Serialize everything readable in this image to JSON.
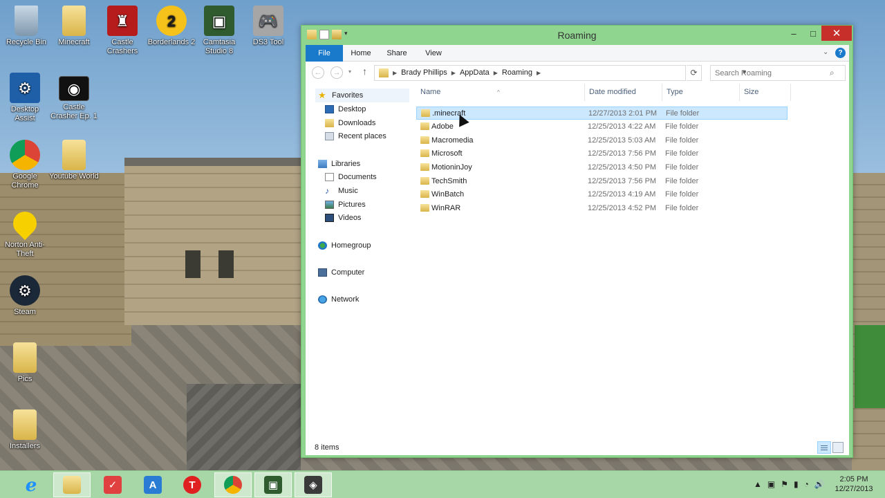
{
  "desktop": {
    "icons": [
      {
        "label": "Recycle Bin",
        "icon": "recycle-bin-icon"
      },
      {
        "label": "Minecraft",
        "icon": "folder-icon"
      },
      {
        "label": "Castle Crashers",
        "icon": "castle-crashers-icon"
      },
      {
        "label": "Borderlands 2",
        "icon": "borderlands-icon"
      },
      {
        "label": "Camtasia Studio 8",
        "icon": "camtasia-icon"
      },
      {
        "label": "DS3 Tool",
        "icon": "gamepad-icon"
      },
      {
        "label": "Desktop Assist",
        "icon": "desktop-assist-icon"
      },
      {
        "label": "Castle Crasher Ep. 1",
        "icon": "video-file-icon"
      },
      {
        "label": "Google Chrome",
        "icon": "chrome-icon"
      },
      {
        "label": "Youtube World",
        "icon": "folder-icon"
      },
      {
        "label": "Norton Anti-Theft",
        "icon": "norton-icon"
      },
      {
        "label": "Steam",
        "icon": "steam-icon"
      },
      {
        "label": "Pics",
        "icon": "folder-icon"
      },
      {
        "label": "Installers",
        "icon": "folder-icon"
      }
    ]
  },
  "window": {
    "title": "Roaming",
    "controls": {
      "minimize": "–",
      "maximize": "□",
      "close": "✕"
    },
    "ribbon": {
      "tabs": [
        "File",
        "Home",
        "Share",
        "View"
      ],
      "help": "?"
    },
    "address": {
      "crumbs": [
        "Brady Phillips",
        "AppData",
        "Roaming"
      ],
      "search_placeholder": "Search Roaming"
    },
    "nav_pane": {
      "favorites": {
        "label": "Favorites",
        "items": [
          "Desktop",
          "Downloads",
          "Recent places"
        ]
      },
      "libraries": {
        "label": "Libraries",
        "items": [
          "Documents",
          "Music",
          "Pictures",
          "Videos"
        ]
      },
      "homegroup": "Homegroup",
      "computer": "Computer",
      "network": "Network"
    },
    "columns": [
      "Name",
      "Date modified",
      "Type",
      "Size"
    ],
    "files": [
      {
        "name": ".minecraft",
        "date": "12/27/2013 2:01 PM",
        "type": "File folder",
        "selected": true
      },
      {
        "name": "Adobe",
        "date": "12/25/2013 4:22 AM",
        "type": "File folder"
      },
      {
        "name": "Macromedia",
        "date": "12/25/2013 5:03 AM",
        "type": "File folder"
      },
      {
        "name": "Microsoft",
        "date": "12/25/2013 7:56 PM",
        "type": "File folder"
      },
      {
        "name": "MotioninJoy",
        "date": "12/25/2013 4:50 PM",
        "type": "File folder"
      },
      {
        "name": "TechSmith",
        "date": "12/25/2013 7:56 PM",
        "type": "File folder"
      },
      {
        "name": "WinBatch",
        "date": "12/25/2013 4:19 AM",
        "type": "File folder"
      },
      {
        "name": "WinRAR",
        "date": "12/25/2013 4:52 PM",
        "type": "File folder"
      }
    ],
    "status": "8 items"
  },
  "taskbar": {
    "apps": [
      "internet-explorer-icon",
      "file-explorer-icon",
      "remember-icon",
      "app-a-icon",
      "app-t-icon",
      "chrome-icon",
      "camtasia-icon",
      "camtasia-recorder-icon"
    ],
    "clock": {
      "time": "2:05 PM",
      "date": "12/27/2013"
    }
  },
  "colors": {
    "window_frame": "#8fd48f",
    "accent": "#1979ca",
    "selection": "#cce8ff",
    "taskbar": "#a7d6a7"
  }
}
